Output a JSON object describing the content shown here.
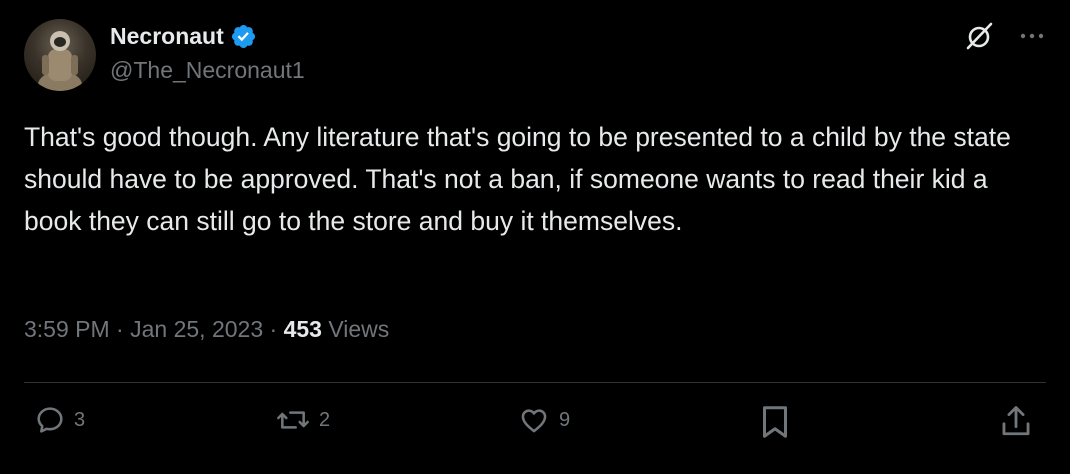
{
  "author": {
    "display_name": "Necronaut",
    "handle": "@The_Necronaut1",
    "verified": true,
    "avatar": "astronaut-avatar"
  },
  "header_actions": {
    "grok_icon": "slashed-circle-icon",
    "more_icon": "ellipsis-icon"
  },
  "tweet": {
    "text": "That's good though. Any literature that's going to be presented to a child by the state should have to be approved. That's not a ban, if someone wants to read their kid a book they can still go to the store and buy it themselves."
  },
  "meta": {
    "time": "3:59 PM",
    "separator": "·",
    "date": "Jan 25, 2023",
    "views_count": "453",
    "views_label": "Views"
  },
  "actions": {
    "reply_count": "3",
    "retweet_count": "2",
    "like_count": "9"
  },
  "colors": {
    "background": "#000000",
    "text": "#e7e9ea",
    "secondary": "#71767b",
    "divider": "#2f3336",
    "verified": "#1d9bf0"
  }
}
